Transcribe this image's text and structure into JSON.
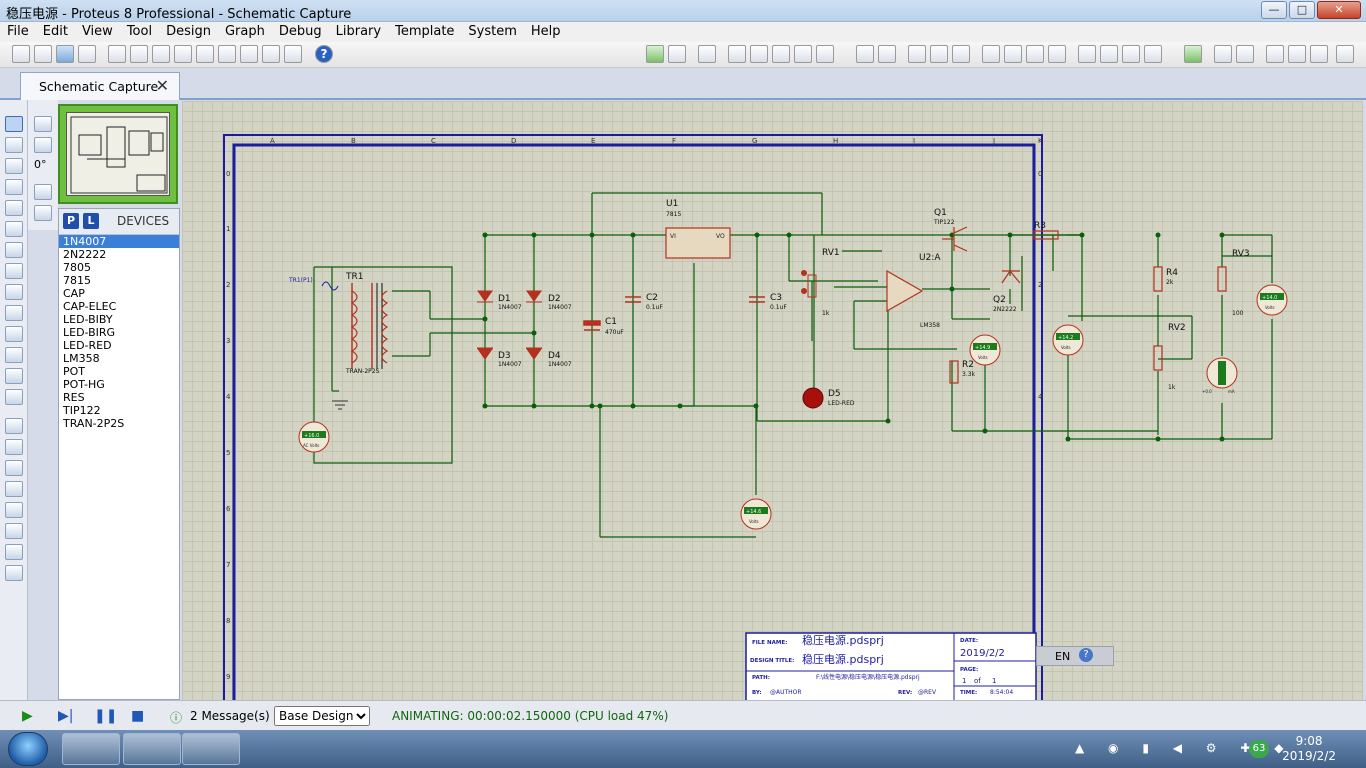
{
  "window": {
    "title": "稳压电源 - Proteus 8 Professional - Schematic Capture",
    "min": "—",
    "max": "□",
    "close": "✕"
  },
  "menu": [
    "File",
    "Edit",
    "View",
    "Tool",
    "Design",
    "Graph",
    "Debug",
    "Library",
    "Template",
    "System",
    "Help"
  ],
  "tab": {
    "label": "Schematic Capture",
    "close": "✕"
  },
  "rotation": "0°",
  "devices": {
    "p_btn": "P",
    "l_btn": "L",
    "header": "DEVICES",
    "items": [
      "1N4007",
      "2N2222",
      "7805",
      "7815",
      "CAP",
      "CAP-ELEC",
      "LED-BIBY",
      "LED-BIRG",
      "LED-RED",
      "LM358",
      "POT",
      "POT-HG",
      "RES",
      "TIP122",
      "TRAN-2P2S"
    ],
    "selected": 0
  },
  "schematic": {
    "col_labels": [
      "A",
      "B",
      "C",
      "D",
      "E",
      "F",
      "G",
      "H",
      "I",
      "J",
      "K"
    ],
    "row_labels": [
      "0",
      "1",
      "2",
      "3",
      "4",
      "5",
      "6",
      "7",
      "8",
      "9"
    ],
    "components": {
      "tr1": "TR1",
      "tr1_type": "TRAN-2P2S",
      "tr1_probe": "TR1(P1)",
      "d1": "D1",
      "d2": "D2",
      "d3": "D3",
      "d4": "D4",
      "diode_val": "1N4007",
      "c1": "C1",
      "c1_val": "470uF",
      "c2": "C2",
      "c2_val": "0.1uF",
      "c3": "C3",
      "c3_val": "0.1uF",
      "u1": "U1",
      "u1_val": "7815",
      "u1_vi": "VI",
      "u1_vo": "VO",
      "u1_gnd": "GND",
      "rv1": "RV1",
      "rv1_val": "1k",
      "d5": "D5",
      "d5_val": "LED-RED",
      "u2": "U2:A",
      "u2_val": "LM358",
      "q1": "Q1",
      "q1_val": "TIP122",
      "q2": "Q2",
      "q2_val": "2N2222",
      "r2": "R2",
      "r2_val": "3.3k",
      "r3": "R3",
      "r4": "R4",
      "r4_val": "2k",
      "rv2": "RV2",
      "rv2_val": "1k",
      "rv3": "RV3",
      "rv3_val": "100"
    },
    "meters": {
      "ac": {
        "reading": "+16.0",
        "unit": "AC Volts"
      },
      "v1": {
        "reading": "+14.6",
        "unit": "Volts"
      },
      "v2": {
        "reading": "+14.9",
        "unit": "Volts"
      },
      "v3": {
        "reading": "+14.2",
        "unit": "Volts"
      },
      "v4": {
        "reading": "+14.0",
        "unit": "Volts"
      },
      "ma": {
        "reading": "+0.0",
        "unit": "mA"
      }
    },
    "title_block": {
      "file_name_label": "FILE NAME:",
      "file_name": "稳压电源.pdsprj",
      "design_title_label": "DESIGN TITLE:",
      "design_title": "稳压电源.pdsprj",
      "path_label": "PATH:",
      "path": "F:\\线性电源\\稳压电源\\稳压电源.pdsprj",
      "by_label": "BY:",
      "by": "@AUTHOR",
      "rev_label": "REV:",
      "rev": "@REV",
      "date_label": "DATE:",
      "date": "2019/2/2",
      "page_label": "PAGE:",
      "page": "1",
      "of": "of",
      "pages": "1",
      "time_label": "TIME:",
      "time": "8:54:04"
    }
  },
  "status": {
    "messages": "2 Message(s)",
    "design": "Base Design",
    "animating": "ANIMATING: 00:00:02.150000 (CPU load 47%)"
  },
  "lang": "EN",
  "clock": {
    "time": "9:08",
    "date": "2019/2/2"
  },
  "tray_badge": "63"
}
